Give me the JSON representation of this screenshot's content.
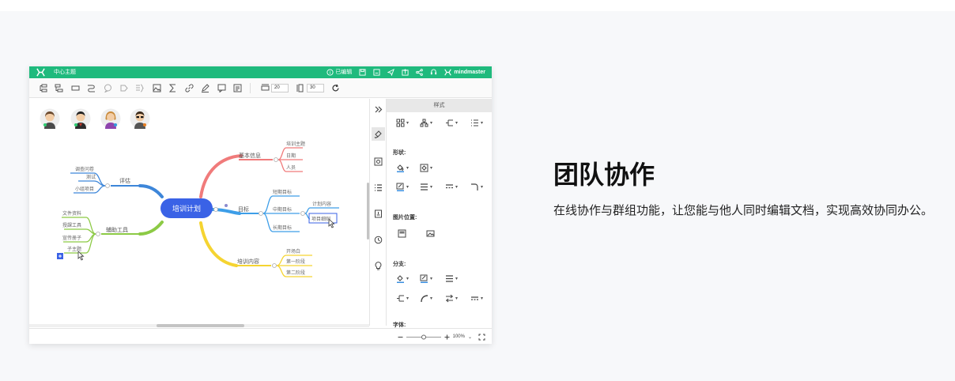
{
  "app": {
    "doc_title": "中心主题",
    "edit_status": "已编辑",
    "brand": "mindmaster",
    "toolbar": {
      "width_value": "20",
      "height_value": "30"
    },
    "panel": {
      "title": "样式",
      "sections": {
        "shape": "形状:",
        "image_position": "图片位置:",
        "branch": "分支:",
        "font": "字体:"
      }
    },
    "zoom": "100%",
    "mindmap": {
      "center": "培训计划",
      "branches": {
        "basic_info": {
          "label": "基本信息",
          "children": [
            "培训主题",
            "日期",
            "人员"
          ]
        },
        "goals": {
          "label": "目标",
          "children": [
            "短期目标",
            "中期目标",
            "长期目标"
          ]
        },
        "goals_mid_children": [
          "计划内容",
          "项目细则"
        ],
        "training_content": {
          "label": "培训内容",
          "children": [
            "开场白",
            "第一阶段",
            "第二阶段"
          ]
        },
        "evaluation": {
          "label": "评估",
          "children": [
            "调查问卷",
            "测试",
            "小组项目"
          ]
        },
        "aux_tools": {
          "label": "辅助工具",
          "children": [
            "文件资料",
            "授課工具",
            "宣传册子",
            "子主题"
          ]
        }
      }
    },
    "colors": {
      "titlebar": "#1fba7d",
      "center": "#3a62e6",
      "basic_info": "#f07b7b",
      "goals": "#3d9ee8",
      "training_content": "#f5d431",
      "evaluation": "#3d86d9",
      "aux_tools": "#8cca45"
    }
  },
  "feature": {
    "title": "团队协作",
    "description": "在线协作与群组功能，让您能与他人同时编辑文档，实现高效协同办公。"
  }
}
